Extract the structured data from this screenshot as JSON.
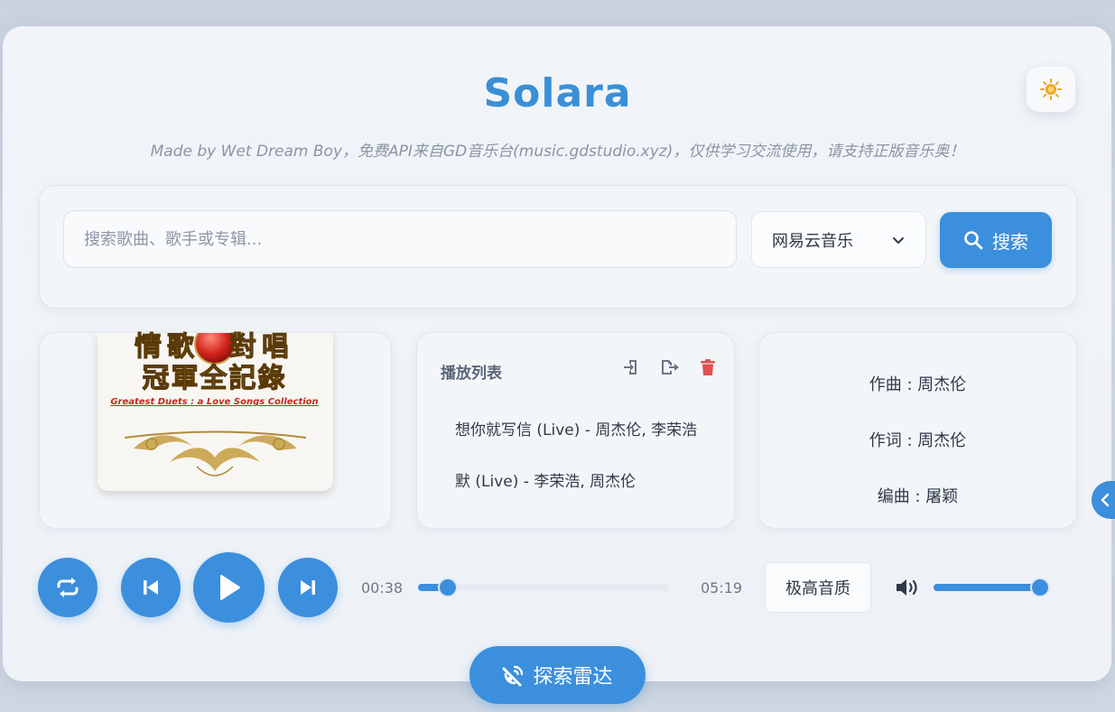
{
  "app": {
    "title": "Solara",
    "subtitle": "Made by Wet Dream Boy，免费API来自GD音乐台(music.gdstudio.xyz)，仅供学习交流使用，请支持正版音乐奥！"
  },
  "search": {
    "placeholder": "搜索歌曲、歌手或专辑...",
    "value": "",
    "source_selected": "网易云音乐",
    "button_label": "搜索"
  },
  "cover": {
    "title_line1": "情歌  對唱",
    "title_line2": "冠軍全記錄",
    "caption": "Greatest Duets : a Love Songs Collection"
  },
  "playlist": {
    "header": "播放列表",
    "items": [
      {
        "label": "想你就写信 (Live) - 周杰伦, 李荣浩"
      },
      {
        "label": "默 (Live) - 李荣浩, 周杰伦"
      }
    ]
  },
  "credits": {
    "composer": "作曲 : 周杰伦",
    "lyricist": "作词 : 周杰伦",
    "arranger": "编曲 : 屠颖"
  },
  "player": {
    "current_time": "00:38",
    "total_time": "05:19",
    "progress": 0.12,
    "quality_label": "极高音质",
    "volume": 1.0
  },
  "explore": {
    "label": "探索雷达"
  },
  "colors": {
    "accent": "#3b8fdd",
    "title": "#3a8fd6",
    "danger": "#e05252",
    "sun": "#f0a020"
  }
}
